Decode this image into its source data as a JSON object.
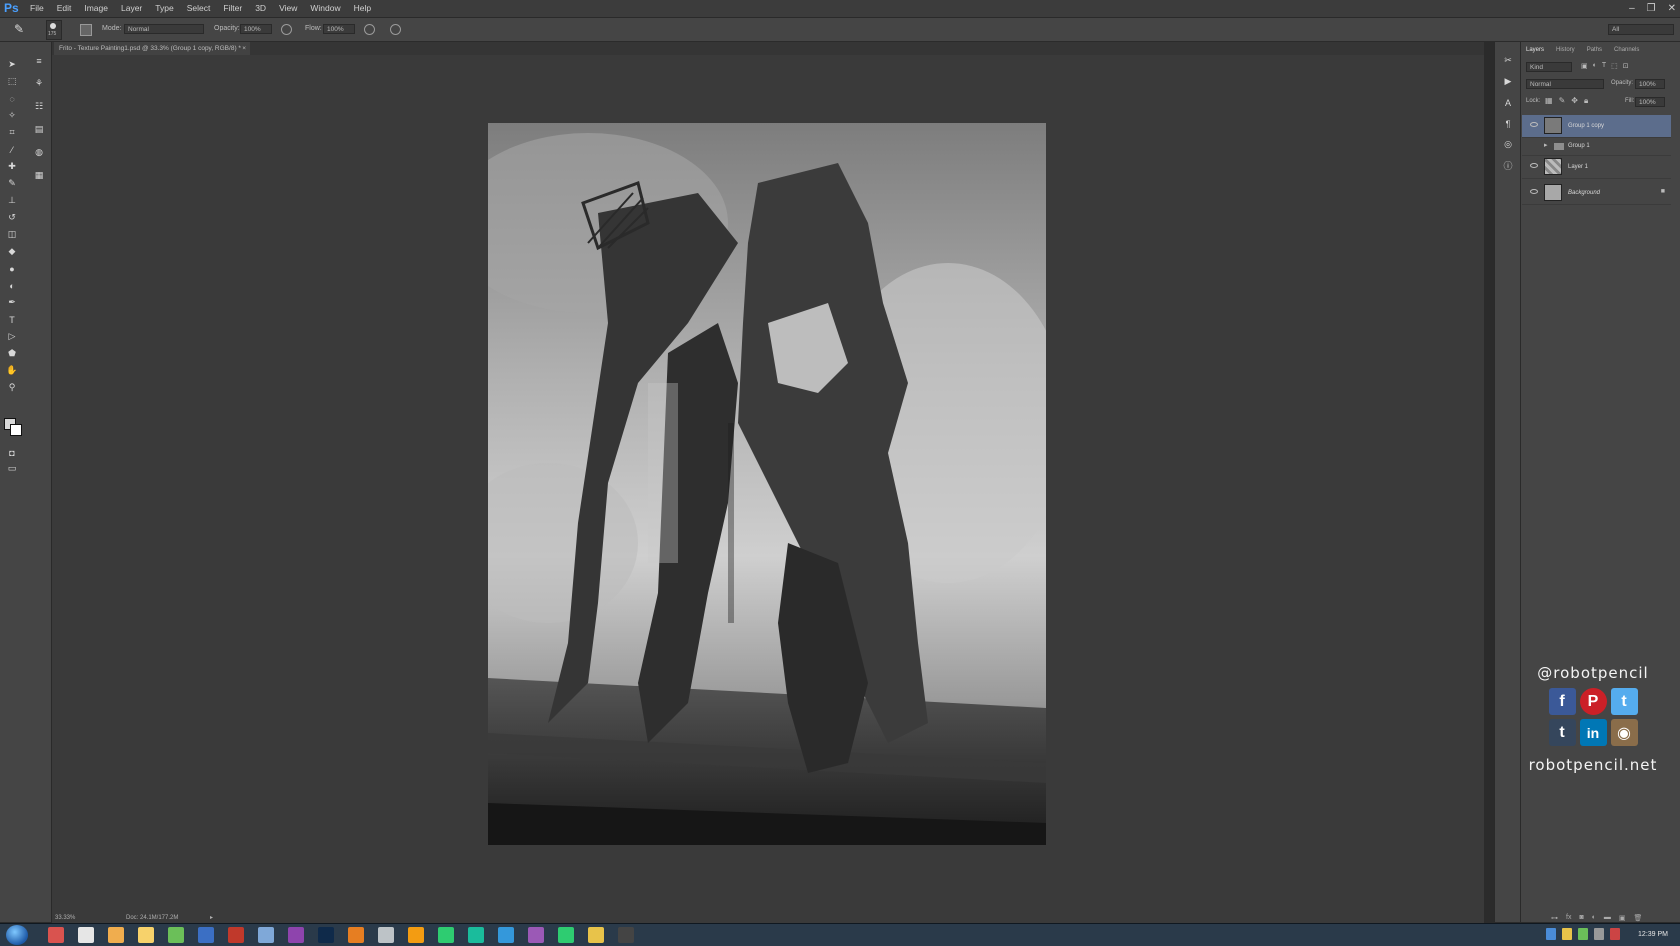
{
  "app": {
    "logo": "Ps",
    "menu": [
      "File",
      "Edit",
      "Image",
      "Layer",
      "Type",
      "Select",
      "Filter",
      "3D",
      "View",
      "Window",
      "Help"
    ]
  },
  "options": {
    "mode_label": "Mode:",
    "mode_value": "Normal",
    "opacity_label": "Opacity:",
    "opacity_value": "100%",
    "flow_label": "Flow:",
    "flow_value": "100%",
    "brush_size": "175",
    "workspace": "All"
  },
  "document": {
    "tab_title": "Frito - Texture Painting1.psd @ 33.3% (Group 1 copy, RGB/8) *",
    "zoom": "33.33%",
    "doc_size": "Doc: 24.1M/177.2M"
  },
  "panels": {
    "tabs": [
      "Layers",
      "History",
      "Paths",
      "Channels"
    ],
    "kind": "Kind",
    "blend_mode": "Normal",
    "opacity_label": "Opacity:",
    "opacity_value": "100%",
    "lock_label": "Lock:",
    "fill_label": "Fill:",
    "fill_value": "100%",
    "layers": [
      {
        "name": "Group 1 copy",
        "selected": true
      },
      {
        "name": "Group 1",
        "selected": false
      },
      {
        "name": "Layer 1",
        "selected": false
      },
      {
        "name": "Background",
        "selected": false
      }
    ]
  },
  "watermark": {
    "handle": "@robotpencil",
    "website": "robotpencil.net",
    "icons": [
      "facebook-icon",
      "pinterest-icon",
      "twitter-icon",
      "tumblr-icon",
      "linkedin-icon",
      "instagram-icon"
    ],
    "icon_glyphs": [
      "f",
      "P",
      "t",
      "t",
      "in",
      "◉"
    ],
    "icon_colors": [
      "#3b5998",
      "#cb2027",
      "#55acee",
      "#35465c",
      "#0077b5",
      "#8a6d4a"
    ]
  },
  "taskbar": {
    "time": "12:39 PM"
  },
  "colors": {
    "accent": "#4aa0ff",
    "selected_layer": "#5c6d8c"
  }
}
